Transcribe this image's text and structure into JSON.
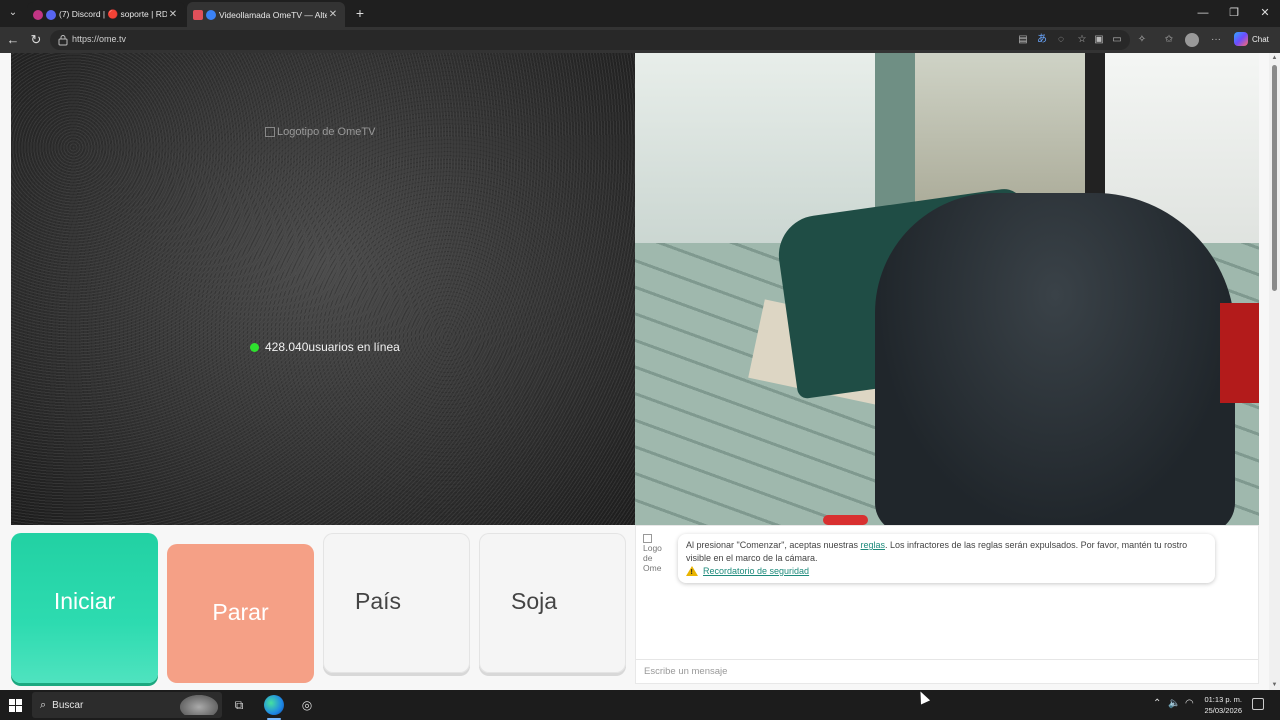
{
  "browser": {
    "tabs": [
      {
        "label": "(7) Discord | 🔴 soporte | RD",
        "favicon_color": "#5865f2",
        "active": false
      },
      {
        "label": "Videollamada OmeTV — Alter",
        "favicon_color": "#3b82f6",
        "active": true
      }
    ],
    "new_tab": "+",
    "window": {
      "minimize": "—",
      "restore": "❐",
      "close": "✕"
    },
    "url": "https://ome.tv",
    "copilot_label": "Chat"
  },
  "page": {
    "left_video": {
      "logo_alt": "Logotipo de OmeTV",
      "online_count": "428.040",
      "online_suffix": "usuarios en línea",
      "online_color": "#2ee02e"
    },
    "buttons": {
      "start": "Iniciar",
      "stop": "Parar",
      "country": "País",
      "gender": "Soja"
    },
    "colors": {
      "start": "#22d1a3",
      "stop": "#f5a086",
      "link": "#1d8a7b"
    },
    "chat": {
      "logo_alt_line1": "Logo",
      "logo_alt_line2": "de",
      "logo_alt_line3": "Ome",
      "notice_before": "Al presionar \"Comenzar\", aceptas nuestras ",
      "notice_link": "reglas",
      "notice_after": ". Los infractores de las reglas serán expulsados. Por favor, mantén tu rostro visible en el marco de la cámara.",
      "safety_link": "Recordatorio de seguridad",
      "input_placeholder": "Escribe un mensaje"
    }
  },
  "taskbar": {
    "search_label": "Buscar",
    "time": "01:13 p. m.",
    "date": "25/03/2026"
  }
}
